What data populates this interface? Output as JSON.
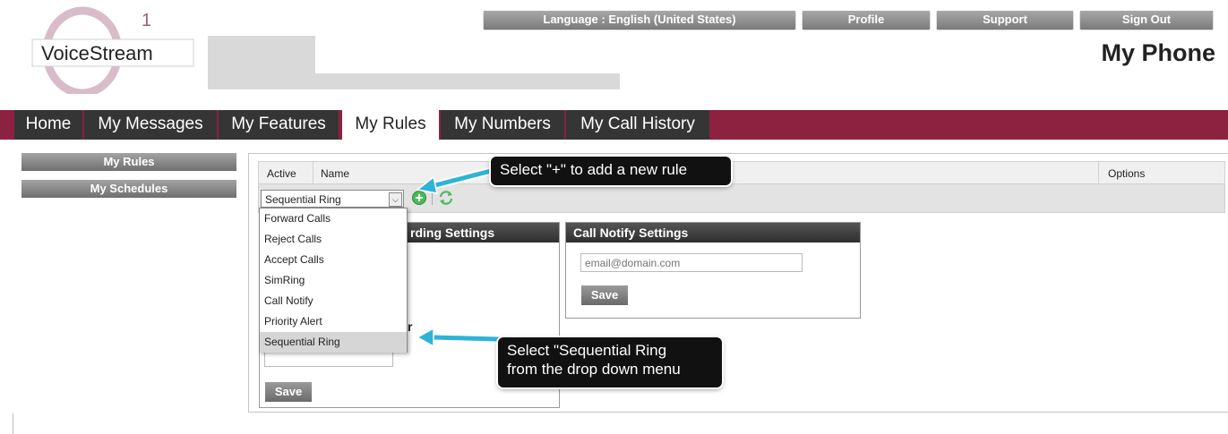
{
  "header": {
    "logo_text": "VoiceStream",
    "logo_superscript": "1",
    "page_title": "My Phone",
    "top_buttons": {
      "language": "Language : English (United States)",
      "profile": "Profile",
      "support": "Support",
      "sign_out": "Sign Out"
    }
  },
  "nav": {
    "tabs": [
      "Home",
      "My Messages",
      "My Features",
      "My Rules",
      "My Numbers",
      "My Call History"
    ],
    "active": "My Rules"
  },
  "sidebar": {
    "items": [
      "My Rules",
      "My Schedules"
    ]
  },
  "rules_table": {
    "col_active": "Active",
    "col_name": "Name",
    "col_options": "Options",
    "select_value": "Sequential Ring",
    "dropdown_options": [
      "Forward Calls",
      "Reject Calls",
      "Accept Calls",
      "SimRing",
      "Call Notify",
      "Priority Alert",
      "Sequential Ring"
    ]
  },
  "panels": {
    "recording_title_fragment": "rding Settings",
    "recording_label_fragment": "r",
    "call_notify_title": "Call Notify Settings",
    "email_placeholder": "email@domain.com",
    "save_label": "Save"
  },
  "callouts": {
    "add_rule": "Select \"+\" to add a new rule",
    "sequential_line1": "Select \"Sequential Ring",
    "sequential_line2": "from the drop down menu"
  },
  "colors": {
    "nav_bar": "#8c2140",
    "nav_tab": "#353535",
    "callout_arrow": "#2fb3d6",
    "add_icon": "#3aa84a"
  }
}
